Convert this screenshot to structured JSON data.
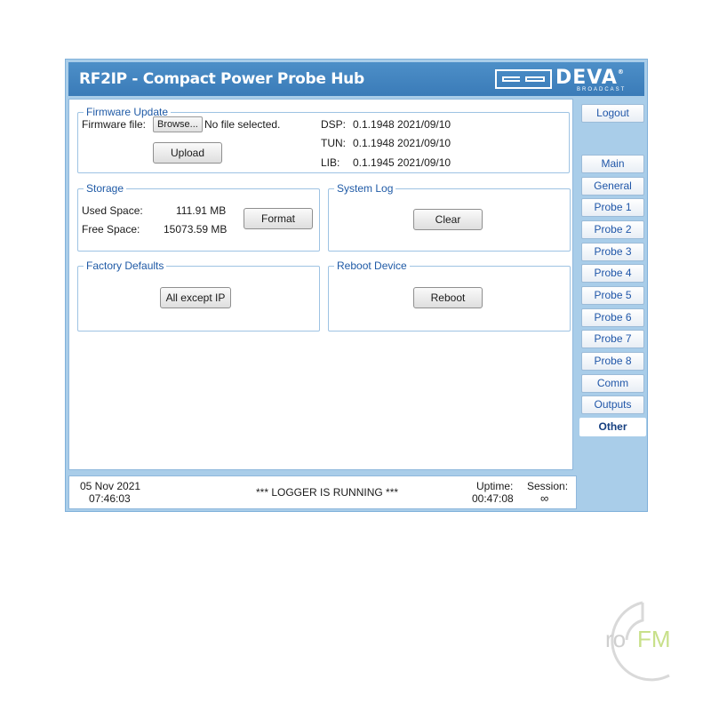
{
  "header": {
    "title": "RF2IP - Compact Power Probe Hub",
    "logo_text": "DEVA",
    "logo_sub": "BROADCAST",
    "logo_reg": "®"
  },
  "firmware": {
    "legend": "Firmware Update",
    "file_label": "Firmware file:",
    "browse_label": "Browse...",
    "file_status": "No file selected.",
    "upload_label": "Upload",
    "versions": [
      {
        "name": "DSP:",
        "value": "0.1.1948 2021/09/10"
      },
      {
        "name": "TUN:",
        "value": "0.1.1948 2021/09/10"
      },
      {
        "name": "LIB:",
        "value": "0.1.1945 2021/09/10"
      }
    ]
  },
  "storage": {
    "legend": "Storage",
    "used_label": "Used Space:",
    "used_value": "111.91 MB",
    "free_label": "Free Space:",
    "free_value": "15073.59 MB",
    "format_label": "Format"
  },
  "system_log": {
    "legend": "System Log",
    "clear_label": "Clear"
  },
  "factory_defaults": {
    "legend": "Factory Defaults",
    "button_label": "All except IP"
  },
  "reboot": {
    "legend": "Reboot Device",
    "button_label": "Reboot"
  },
  "sidebar": {
    "logout_label": "Logout",
    "items": [
      {
        "label": "Main",
        "active": false
      },
      {
        "label": "General",
        "active": false
      },
      {
        "label": "Probe 1",
        "active": false
      },
      {
        "label": "Probe 2",
        "active": false
      },
      {
        "label": "Probe 3",
        "active": false
      },
      {
        "label": "Probe 4",
        "active": false
      },
      {
        "label": "Probe 5",
        "active": false
      },
      {
        "label": "Probe 6",
        "active": false
      },
      {
        "label": "Probe 7",
        "active": false
      },
      {
        "label": "Probe 8",
        "active": false
      },
      {
        "label": "Comm",
        "active": false
      },
      {
        "label": "Outputs",
        "active": false
      },
      {
        "label": "Other",
        "active": true
      }
    ]
  },
  "status": {
    "date": "05 Nov 2021",
    "time": "07:46:03",
    "message": "*** LOGGER IS RUNNING ***",
    "uptime_label": "Uptime:",
    "uptime_value": "00:47:08",
    "session_label": "Session:",
    "session_value": "∞"
  },
  "watermark": {
    "text_dark": "ro",
    "text_accent": "FM"
  },
  "colors": {
    "header": "#3a7bb8",
    "frame": "#a9cde9",
    "link": "#1f56a8",
    "legend": "#1f5aa6",
    "watermark_accent": "#c8e08a"
  }
}
